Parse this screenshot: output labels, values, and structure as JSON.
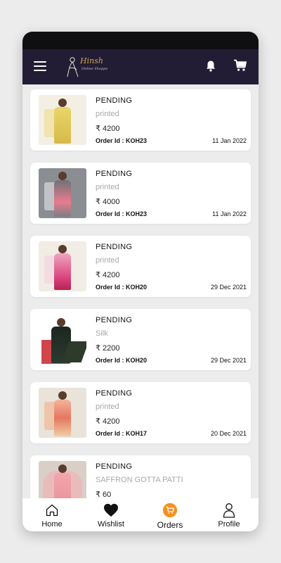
{
  "app": {
    "brand": "Hinsh",
    "tagline": "Online Shoppe",
    "colors": {
      "appbar": "#221d34",
      "accent": "#f5911e",
      "gold": "#d3a24c"
    }
  },
  "header": {
    "menu_icon": "hamburger-menu-icon",
    "notification_icon": "bell-icon",
    "cart_icon": "cart-icon"
  },
  "orders": [
    {
      "status": "PENDING",
      "fabric": "printed",
      "price": "₹ 4200",
      "order_id": "Order Id : KOH23",
      "date": "11 Jan 2022"
    },
    {
      "status": "PENDING",
      "fabric": "printed",
      "price": "₹ 4000",
      "order_id": "Order Id : KOH23",
      "date": "11 Jan 2022"
    },
    {
      "status": "PENDING",
      "fabric": "printed",
      "price": "₹ 4200",
      "order_id": "Order Id : KOH20",
      "date": "29 Dec 2021"
    },
    {
      "status": "PENDING",
      "fabric": "Silk",
      "price": "₹ 2200",
      "order_id": "Order Id : KOH20",
      "date": "29 Dec 2021"
    },
    {
      "status": "PENDING",
      "fabric": "printed",
      "price": "₹ 4200",
      "order_id": "Order Id : KOH17",
      "date": "20 Dec 2021"
    },
    {
      "status": "PENDING",
      "fabric": "SAFFRON GOTTA PATTI",
      "price": "₹ 60",
      "order_id": "",
      "date": ""
    }
  ],
  "bottom_nav": [
    {
      "label": "Home",
      "icon": "home-icon",
      "active": false
    },
    {
      "label": "Wishlist",
      "icon": "heart-icon",
      "active": false
    },
    {
      "label": "Orders",
      "icon": "orders-cart-icon",
      "active": true
    },
    {
      "label": "Profile",
      "icon": "profile-icon",
      "active": false
    }
  ]
}
